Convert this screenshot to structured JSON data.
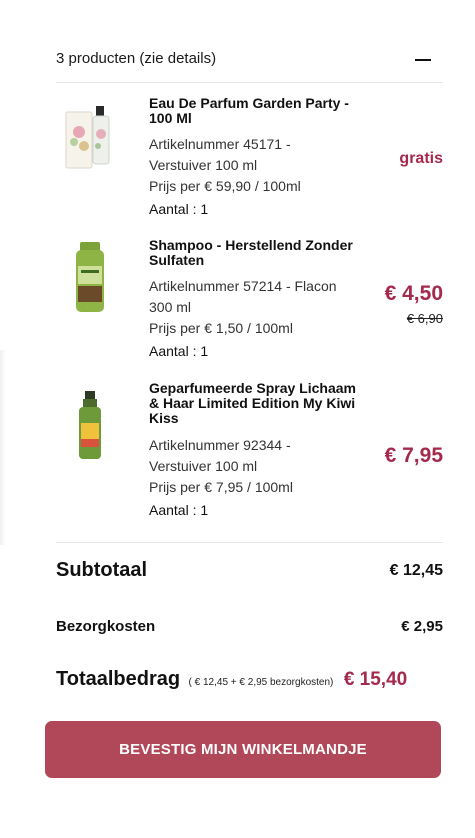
{
  "summary": {
    "title": "3 producten (zie details)",
    "toggle_icon": "minus-icon"
  },
  "products": [
    {
      "name": "Eau De Parfum Garden Party - 100 Ml",
      "article_line": "Artikelnummer 45171 - Verstuiver 100 ml",
      "unit_price": "Prijs per € 59,90 / 100ml",
      "quantity": "Aantal : 1",
      "price": "gratis",
      "image_icon": "perfume-bottle-image"
    },
    {
      "name": "Shampoo - Herstellend Zonder Sulfaten",
      "article_line": "Artikelnummer 57214 - Flacon 300 ml",
      "unit_price": "Prijs per € 1,50 / 100ml",
      "quantity": "Aantal : 1",
      "price": "€ 4,50",
      "old_price": "€ 6,90",
      "image_icon": "shampoo-bottle-image"
    },
    {
      "name": "Geparfumeerde Spray Lichaam & Haar Limited Edition My Kiwi Kiss",
      "article_line": "Artikelnummer 92344 - Verstuiver 100 ml",
      "unit_price": "Prijs per € 7,95 / 100ml",
      "quantity": "Aantal : 1",
      "price": "€ 7,95",
      "image_icon": "spray-bottle-image"
    }
  ],
  "totals": {
    "subtotal_label": "Subtotaal",
    "subtotal_value": "€ 12,45",
    "shipping_label": "Bezorgkosten",
    "shipping_value": "€ 2,95",
    "total_label": "Totaalbedrag",
    "total_note": "( € 12,45 + € 2,95 bezorgkosten)",
    "total_value": "€ 15,40"
  },
  "actions": {
    "confirm_label": "BEVESTIG MIJN WINKELMANDJE"
  },
  "colors": {
    "accent": "#a32a4d",
    "button": "#b0485a"
  }
}
